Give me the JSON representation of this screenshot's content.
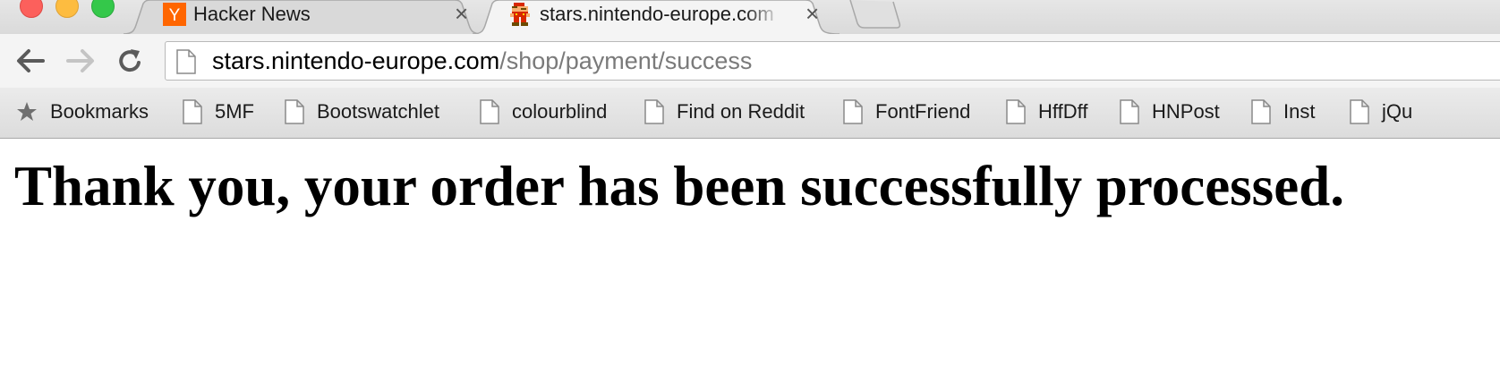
{
  "tabs": [
    {
      "title": "Hacker News",
      "favicon": "y-combinator-icon",
      "favicon_text": "Y",
      "favicon_color": "#ff6600",
      "active": false
    },
    {
      "title": "stars.nintendo-europe.com",
      "favicon": "mario-sprite-icon",
      "active": true
    }
  ],
  "address_bar": {
    "host": "stars.nintendo-europe.com",
    "path": "/shop/payment/success"
  },
  "bookmarks": [
    {
      "label": "Bookmarks",
      "icon": "star-icon"
    },
    {
      "label": "5MF",
      "icon": "page-icon"
    },
    {
      "label": "Bootswatchlet",
      "icon": "page-icon"
    },
    {
      "label": "colourblind",
      "icon": "page-icon"
    },
    {
      "label": "Find on Reddit",
      "icon": "page-icon"
    },
    {
      "label": "FontFriend",
      "icon": "page-icon"
    },
    {
      "label": "HffDff",
      "icon": "page-icon"
    },
    {
      "label": "HNPost",
      "icon": "page-icon"
    },
    {
      "label": "Inst",
      "icon": "page-icon"
    },
    {
      "label": "jQu",
      "icon": "page-icon"
    }
  ],
  "page": {
    "heading": "Thank you, your order has been successfully processed."
  }
}
